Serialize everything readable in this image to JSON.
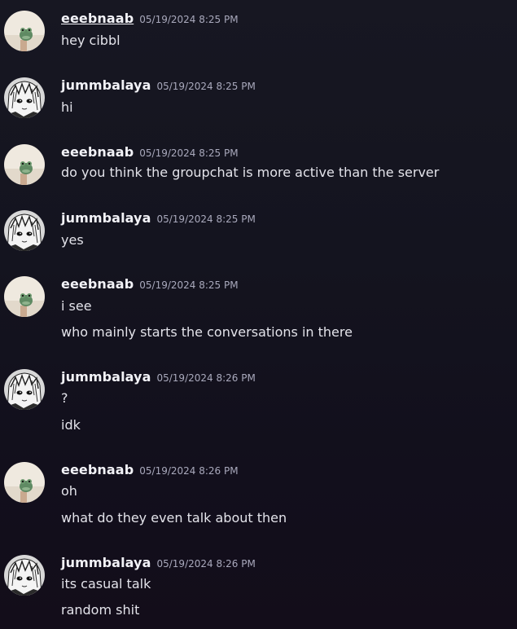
{
  "messages": [
    {
      "username": "eeebnaab",
      "timestamp": "05/19/2024 8:25 PM",
      "avatar": "frog-avatar-icon",
      "lines": [
        "hey cibbl"
      ]
    },
    {
      "username": "jummbalaya",
      "timestamp": "05/19/2024 8:25 PM",
      "avatar": "manga-avatar-icon",
      "lines": [
        "hi"
      ]
    },
    {
      "username": "eeebnaab",
      "timestamp": "05/19/2024 8:25 PM",
      "avatar": "frog-avatar-icon",
      "lines": [
        "do you think the groupchat is more active than the server"
      ]
    },
    {
      "username": "jummbalaya",
      "timestamp": "05/19/2024 8:25 PM",
      "avatar": "manga-avatar-icon",
      "lines": [
        "yes"
      ]
    },
    {
      "username": "eeebnaab",
      "timestamp": "05/19/2024 8:25 PM",
      "avatar": "frog-avatar-icon",
      "lines": [
        "i see",
        "who mainly starts the conversations in there"
      ]
    },
    {
      "username": "jummbalaya",
      "timestamp": "05/19/2024 8:26 PM",
      "avatar": "manga-avatar-icon",
      "lines": [
        "?",
        "idk"
      ]
    },
    {
      "username": "eeebnaab",
      "timestamp": "05/19/2024 8:26 PM",
      "avatar": "frog-avatar-icon",
      "lines": [
        "oh",
        "what do they even talk about then"
      ]
    },
    {
      "username": "jummbalaya",
      "timestamp": "05/19/2024 8:26 PM",
      "avatar": "manga-avatar-icon",
      "lines": [
        "its casual talk",
        "random shit"
      ]
    }
  ]
}
